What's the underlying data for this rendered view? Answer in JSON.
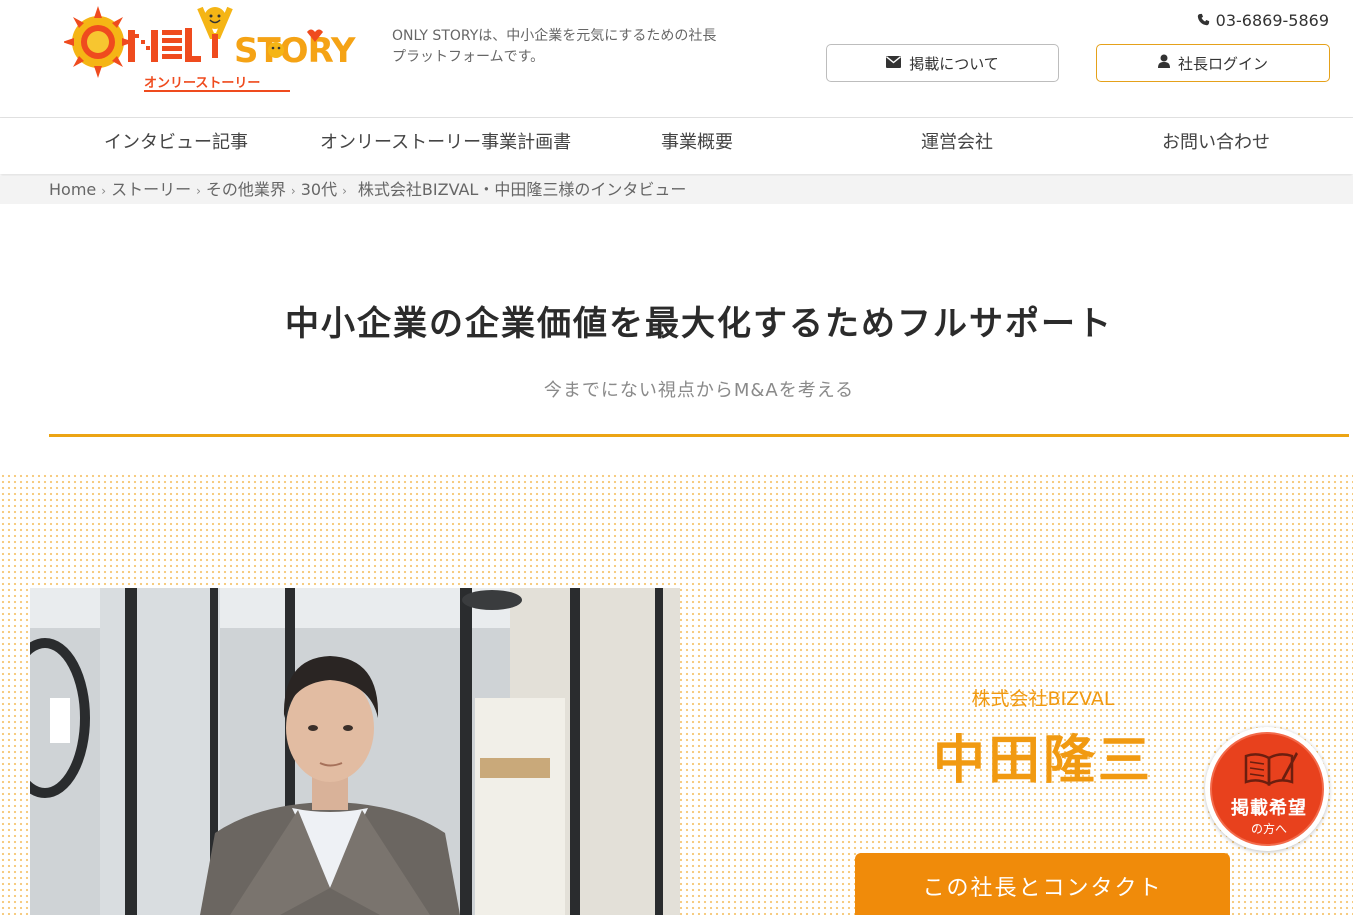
{
  "header": {
    "logo_text": "ONLY STORY",
    "logo_sub": "オンリーストーリー",
    "tagline": "ONLY STORYは、中小企業を元気にするための社長プラットフォームです。",
    "phone": "03-6869-5869",
    "keisai_label": "掲載について",
    "login_label": "社長ログイン"
  },
  "nav": {
    "items": [
      "インタビュー記事",
      "オンリーストーリー事業計画書",
      "事業概要",
      "運営会社",
      "お問い合わせ"
    ]
  },
  "breadcrumb": {
    "home": "Home",
    "story": "ストーリー",
    "industry": "その他業界",
    "age": "30代",
    "current": "株式会社BIZVAL・中田隆三様のインタビュー"
  },
  "hero": {
    "title": "中小企業の企業価値を最大化するためフルサポート",
    "subtitle": "今までにない視点からM&Aを考える"
  },
  "profile": {
    "company": "株式会社BIZVAL",
    "name": "中田隆三",
    "contact_label": "この社長とコンタクト"
  },
  "badge": {
    "line1": "掲載希望",
    "line2": "の方へ"
  },
  "colors": {
    "accent": "#f19a11",
    "rule": "#eca414",
    "button": "#f08b0a",
    "badge": "#e8411d"
  },
  "icons": [
    "phone-icon",
    "envelope-icon",
    "user-icon",
    "book-pen-icon"
  ]
}
